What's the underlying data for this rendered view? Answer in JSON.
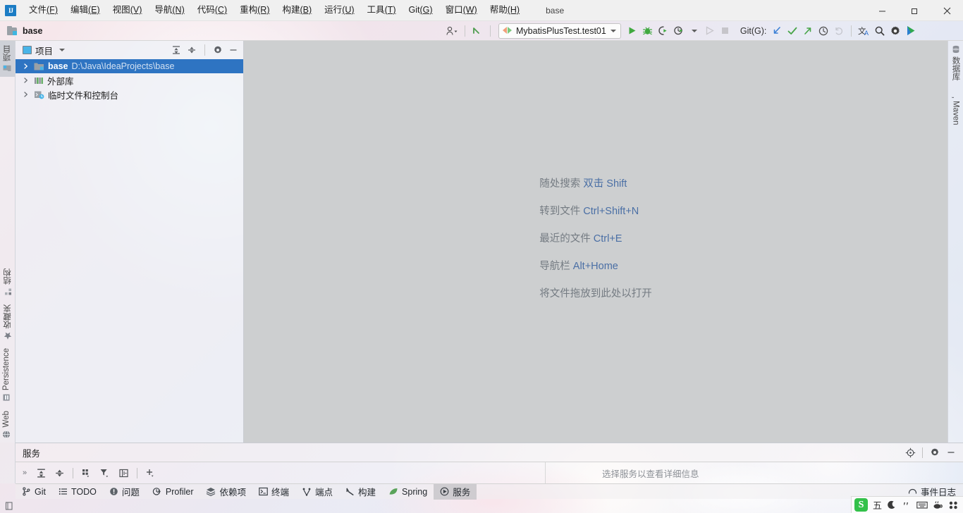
{
  "window": {
    "title": "base",
    "minimize_label": "─",
    "maximize_label": "❐",
    "close_label": "✕"
  },
  "menubar": {
    "items": [
      {
        "label": "文件",
        "mnemonic": "(F)"
      },
      {
        "label": "编辑",
        "mnemonic": "(E)"
      },
      {
        "label": "视图",
        "mnemonic": "(V)"
      },
      {
        "label": "导航",
        "mnemonic": "(N)"
      },
      {
        "label": "代码",
        "mnemonic": "(C)"
      },
      {
        "label": "重构",
        "mnemonic": "(R)"
      },
      {
        "label": "构建",
        "mnemonic": "(B)"
      },
      {
        "label": "运行",
        "mnemonic": "(U)"
      },
      {
        "label": "工具",
        "mnemonic": "(T)"
      },
      {
        "label": "Git",
        "mnemonic": "(G)"
      },
      {
        "label": "窗口",
        "mnemonic": "(W)"
      },
      {
        "label": "帮助",
        "mnemonic": "(H)"
      }
    ]
  },
  "toolbar": {
    "navbar_project": "base",
    "run_config": "MybatisPlusTest.test01",
    "git_label": "Git(G):",
    "icons": {
      "user": "user-avatar-icon",
      "update": "update-project-icon",
      "run": "run-icon",
      "debug": "debug-icon",
      "run_coverage": "run-with-coverage-icon",
      "profiler": "profiler-icon",
      "stop": "stop-icon",
      "pull": "git-pull-icon",
      "commit": "git-commit-icon",
      "push": "git-push-icon",
      "history": "git-history-icon",
      "rollback": "git-rollback-icon",
      "translate": "translate-icon",
      "search": "search-everywhere-icon",
      "settings": "settings-icon",
      "ai": "ai-assistant-icon"
    }
  },
  "left_stripe": {
    "top": [
      {
        "label": "项目",
        "icon": "project-folder-icon",
        "active": true
      }
    ],
    "bottom": [
      {
        "label": "结构",
        "icon": "structure-icon"
      },
      {
        "label": "收藏夹",
        "icon": "bookmarks-star-icon"
      },
      {
        "label": "Persistence",
        "icon": "persistence-icon"
      },
      {
        "label": "Web",
        "icon": "web-globe-icon"
      }
    ]
  },
  "right_stripe": {
    "items": [
      {
        "label": "数据库",
        "icon": "database-icon"
      },
      {
        "label": "Maven",
        "icon": "maven-m-icon"
      }
    ]
  },
  "project_panel": {
    "title": "项目",
    "tools": [
      {
        "name": "expand-all-icon",
        "title": "展开"
      },
      {
        "name": "collapse-all-icon",
        "title": "全部折叠"
      },
      {
        "name": "settings-gear-icon",
        "title": "选项"
      },
      {
        "name": "hide-panel-icon",
        "title": "隐藏"
      }
    ],
    "tree": [
      {
        "label": "base",
        "path": "D:\\Java\\IdeaProjects\\base",
        "bold": true,
        "selected": true,
        "icon": "module-folder-icon",
        "expandable": true
      },
      {
        "label": "外部库",
        "path": "",
        "bold": false,
        "selected": false,
        "icon": "external-libraries-icon",
        "expandable": true
      },
      {
        "label": "临时文件和控制台",
        "path": "",
        "bold": false,
        "selected": false,
        "icon": "scratches-consoles-icon",
        "expandable": true
      }
    ]
  },
  "editor": {
    "hints": [
      {
        "text": "随处搜索 ",
        "key": "双击 Shift"
      },
      {
        "text": "转到文件 ",
        "key": "Ctrl+Shift+N"
      },
      {
        "text": "最近的文件 ",
        "key": "Ctrl+E"
      },
      {
        "text": "导航栏 ",
        "key": "Alt+Home"
      },
      {
        "text": "将文件拖放到此处以打开",
        "key": ""
      }
    ]
  },
  "services": {
    "title": "服务",
    "empty_message": "选择服务以查看详细信息",
    "header_tools": [
      {
        "name": "locate-icon"
      },
      {
        "name": "settings-gear-icon"
      },
      {
        "name": "hide-panel-icon"
      }
    ],
    "toolbar": [
      {
        "name": "more-chevrons-icon",
        "label": "»"
      },
      {
        "name": "expand-all-icon"
      },
      {
        "name": "collapse-all-icon"
      },
      {
        "name": "group-by-icon"
      },
      {
        "name": "filter-icon"
      },
      {
        "name": "show-configurations-icon"
      },
      {
        "name": "add-service-icon"
      }
    ]
  },
  "bottom_tabs": [
    {
      "label": "Git",
      "icon": "git-branch-icon",
      "active": false
    },
    {
      "label": "TODO",
      "icon": "todo-list-icon",
      "active": false
    },
    {
      "label": "问题",
      "icon": "problems-icon",
      "active": false
    },
    {
      "label": "Profiler",
      "icon": "profiler-icon",
      "active": false
    },
    {
      "label": "依赖项",
      "icon": "dependencies-icon",
      "active": false
    },
    {
      "label": "终端",
      "icon": "terminal-icon",
      "active": false
    },
    {
      "label": "端点",
      "icon": "endpoints-icon",
      "active": false
    },
    {
      "label": "构建",
      "icon": "build-hammer-icon",
      "active": false
    },
    {
      "label": "Spring",
      "icon": "spring-leaf-icon",
      "active": false
    },
    {
      "label": "服务",
      "icon": "services-icon",
      "active": true
    }
  ],
  "event_log": {
    "label": "事件日志",
    "icon": "event-log-icon"
  },
  "statusbar": {
    "icon": "memory-indicator-icon"
  },
  "ime_tray": {
    "logo": "S",
    "items": [
      {
        "label": "五",
        "name": "ime-wubi-mode"
      },
      {
        "label": "☽",
        "name": "ime-moon-icon"
      },
      {
        "label": "ʼʼ",
        "name": "ime-punctuation-icon"
      },
      {
        "label": "⌨",
        "name": "ime-keyboard-icon"
      },
      {
        "label": "☕",
        "name": "ime-toolbox-icon"
      },
      {
        "label": "⁙",
        "name": "ime-apps-icon"
      }
    ]
  },
  "colors": {
    "selection_blue": "#2e74c2",
    "editor_bg": "#cdcfd0",
    "hint_key": "#4a6fa5",
    "accent_green": "#4fa34f"
  }
}
